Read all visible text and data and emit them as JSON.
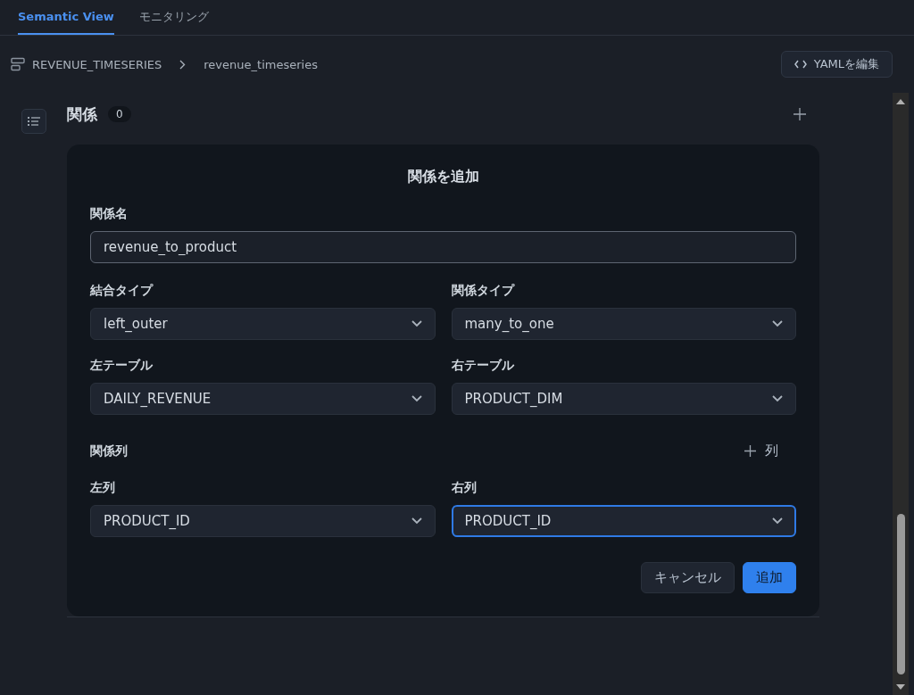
{
  "tabs": [
    {
      "label": "Semantic View",
      "selected": true
    },
    {
      "label": "モニタリング",
      "selected": false
    }
  ],
  "breadcrumb": {
    "parent": "REVENUE_TIMESERIES",
    "current": "revenue_timeseries"
  },
  "edit_yaml_button": "YAMLを編集",
  "section": {
    "title": "関係",
    "count": "0"
  },
  "dialog": {
    "title": "関係を追加",
    "name_field": {
      "label": "関係名",
      "value": "revenue_to_product"
    },
    "selects": [
      {
        "label": "結合タイプ",
        "value": "left_outer",
        "focused": false
      },
      {
        "label": "関係タイプ",
        "value": "many_to_one",
        "focused": false
      },
      {
        "label": "左テーブル",
        "value": "DAILY_REVENUE",
        "focused": false
      },
      {
        "label": "右テーブル",
        "value": "PRODUCT_DIM",
        "focused": false
      }
    ],
    "columns_section": {
      "label": "関係列",
      "add_label": "列"
    },
    "column_selects": [
      {
        "label": "左列",
        "value": "PRODUCT_ID",
        "focused": false
      },
      {
        "label": "右列",
        "value": "PRODUCT_ID",
        "focused": true
      }
    ],
    "buttons": [
      {
        "label": "キャンセル",
        "kind": "secondary"
      },
      {
        "label": "追加",
        "kind": "primary"
      }
    ]
  }
}
